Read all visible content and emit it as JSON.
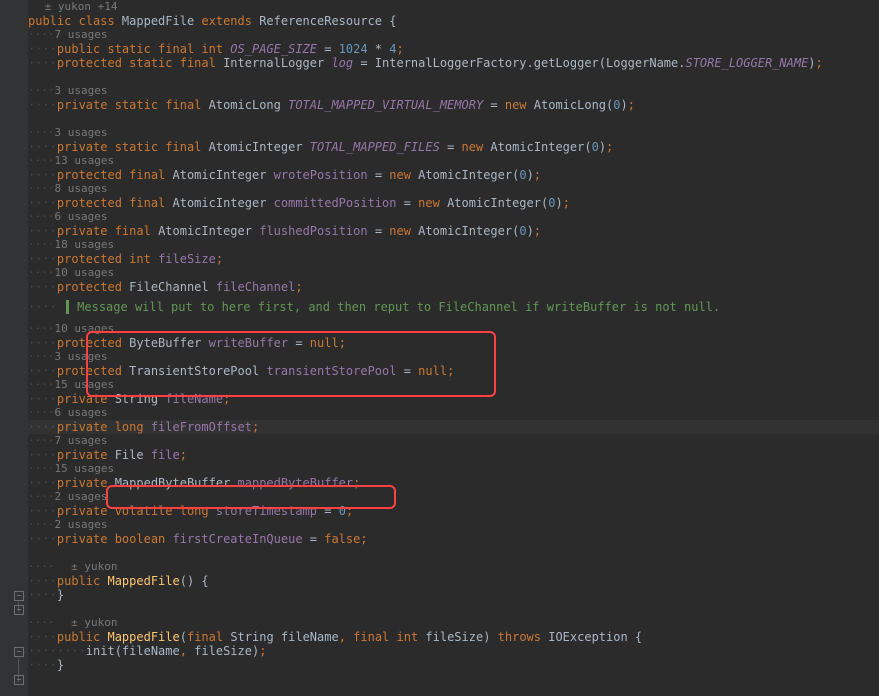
{
  "author1": "± yukon +14",
  "author2": "± yukon",
  "author3": "± yukon",
  "u7": "7 usages",
  "u3": "3 usages",
  "u3b": "3 usages",
  "u13": "13 usages",
  "u8": "8 usages",
  "u6": "6 usages",
  "u18": "18 usages",
  "u10": "10 usages",
  "u10b": "10 usages",
  "u3c": "3 usages",
  "u15": "15 usages",
  "u6b": "6 usages",
  "u7b": "7 usages",
  "u15b": "15 usages",
  "u2": "2 usages",
  "u2b": "2 usages",
  "doccomment": "Message will put to here first, and then reput to FileChannel if writeBuffer is not null.",
  "l_classdecl_1": "public class ",
  "l_classdecl_2": "MappedFile ",
  "l_classdecl_3": "extends ",
  "l_classdecl_4": "ReferenceResource {",
  "l_ospage_1": "public static final int ",
  "l_ospage_2": "OS_PAGE_SIZE ",
  "l_ospage_3": "= ",
  "l_ospage_4": "1024 ",
  "l_ospage_5": "* ",
  "l_ospage_6": "4",
  "l_log_1": "protected static final ",
  "l_log_2": "InternalLogger ",
  "l_log_3": "log ",
  "l_log_4": "= InternalLoggerFactory.getLogger(LoggerName.",
  "l_log_5": "STORE_LOGGER_NAME",
  "l_log_6": ")",
  "l_tmvm_1": "private static final ",
  "l_tmvm_2": "AtomicLong ",
  "l_tmvm_3": "TOTAL_MAPPED_VIRTUAL_MEMORY ",
  "l_tmvm_4": "= ",
  "l_tmvm_5": "new ",
  "l_tmvm_6": "AtomicLong(",
  "l_tmvm_7": "0",
  "l_tmvm_8": ")",
  "l_tmf_1": "private static final ",
  "l_tmf_2": "AtomicInteger ",
  "l_tmf_3": "TOTAL_MAPPED_FILES ",
  "l_tmf_4": "= ",
  "l_tmf_5": "new ",
  "l_tmf_6": "AtomicInteger(",
  "l_tmf_7": "0",
  "l_tmf_8": ")",
  "l_wp_1": "protected final ",
  "l_wp_2": "AtomicInteger ",
  "l_wp_3": "wrotePosition ",
  "l_wp_4": "= ",
  "l_wp_5": "new ",
  "l_wp_6": "AtomicInteger(",
  "l_wp_7": "0",
  "l_wp_8": ")",
  "l_cp_1": "protected final ",
  "l_cp_2": "AtomicInteger ",
  "l_cp_3": "committedPosition ",
  "l_cp_4": "= ",
  "l_cp_5": "new ",
  "l_cp_6": "AtomicInteger(",
  "l_cp_7": "0",
  "l_cp_8": ")",
  "l_fp_1": "private final ",
  "l_fp_2": "AtomicInteger ",
  "l_fp_3": "flushedPosition ",
  "l_fp_4": "= ",
  "l_fp_5": "new ",
  "l_fp_6": "AtomicInteger(",
  "l_fp_7": "0",
  "l_fp_8": ")",
  "l_fs_1": "protected int ",
  "l_fs_2": "fileSize",
  "l_fc_1": "protected ",
  "l_fc_2": "FileChannel ",
  "l_fc_3": "fileChannel",
  "l_wb_1": "protected ",
  "l_wb_2": "ByteBuffer ",
  "l_wb_3": "writeBuffer ",
  "l_wb_4": "= ",
  "l_wb_5": "null",
  "l_tsp_1": "protected ",
  "l_tsp_2": "TransientStorePool ",
  "l_tsp_3": "transientStorePool ",
  "l_tsp_4": "= ",
  "l_tsp_5": "null",
  "l_fn_1": "private ",
  "l_fn_2": "String ",
  "l_fn_3": "fileName",
  "l_ffo_1": "private long ",
  "l_ffo_2": "fileFromOffset",
  "l_file_1": "private ",
  "l_file_2": "File ",
  "l_file_3": "file",
  "l_mbb_1": "private ",
  "l_mbb_2": "MappedByteBuffer ",
  "l_mbb_3": "mappedByteBuffer",
  "l_st_1": "private volatile long ",
  "l_st_2": "storeTimestamp ",
  "l_st_3": "= ",
  "l_st_4": "0",
  "l_fciq_1": "private boolean ",
  "l_fciq_2": "firstCreateInQueue ",
  "l_fciq_3": "= ",
  "l_fciq_4": "false",
  "l_ctor1_1": "public ",
  "l_ctor1_2": "MappedFile",
  "l_ctor1_3": "() {",
  "l_close": "}",
  "l_ctor2_1": "public ",
  "l_ctor2_2": "MappedFile",
  "l_ctor2_3": "(",
  "l_ctor2_4": "final ",
  "l_ctor2_5": "String fileName",
  "l_ctor2_6": ", ",
  "l_ctor2_7": "final int ",
  "l_ctor2_8": "fileSize) ",
  "l_ctor2_9": "throws ",
  "l_ctor2_10": "IOException {",
  "l_init_1": "init(fileName",
  "l_init_2": ", ",
  "l_init_3": "fileSize)",
  "dots4": "····",
  "dots8": "········",
  "semi": ";"
}
